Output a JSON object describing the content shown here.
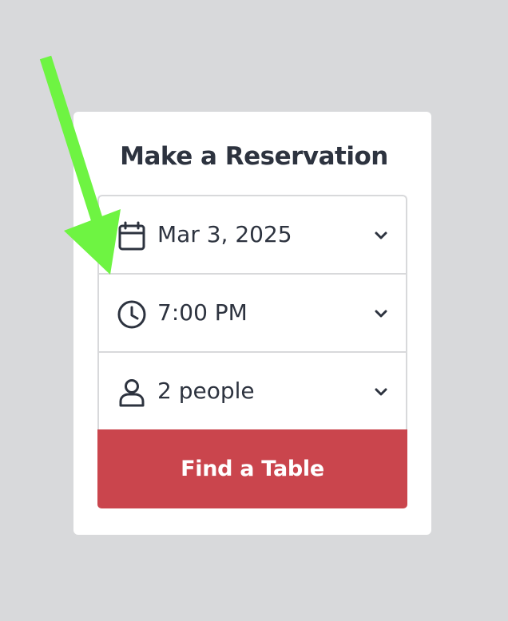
{
  "reservation": {
    "title": "Make a Reservation",
    "date": {
      "value": "Mar 3, 2025",
      "icon": "calendar-icon"
    },
    "time": {
      "value": "7:00 PM",
      "icon": "clock-icon"
    },
    "party_size": {
      "value": "2 people",
      "icon": "person-icon"
    },
    "submit_label": "Find a Table"
  },
  "colors": {
    "background": "#d8d9db",
    "card": "#ffffff",
    "text": "#2d333f",
    "border": "#d8d9db",
    "button": "#ca454d",
    "annotation_arrow": "#6ef442"
  },
  "annotation": {
    "type": "arrow",
    "points_to": "time-picker"
  }
}
